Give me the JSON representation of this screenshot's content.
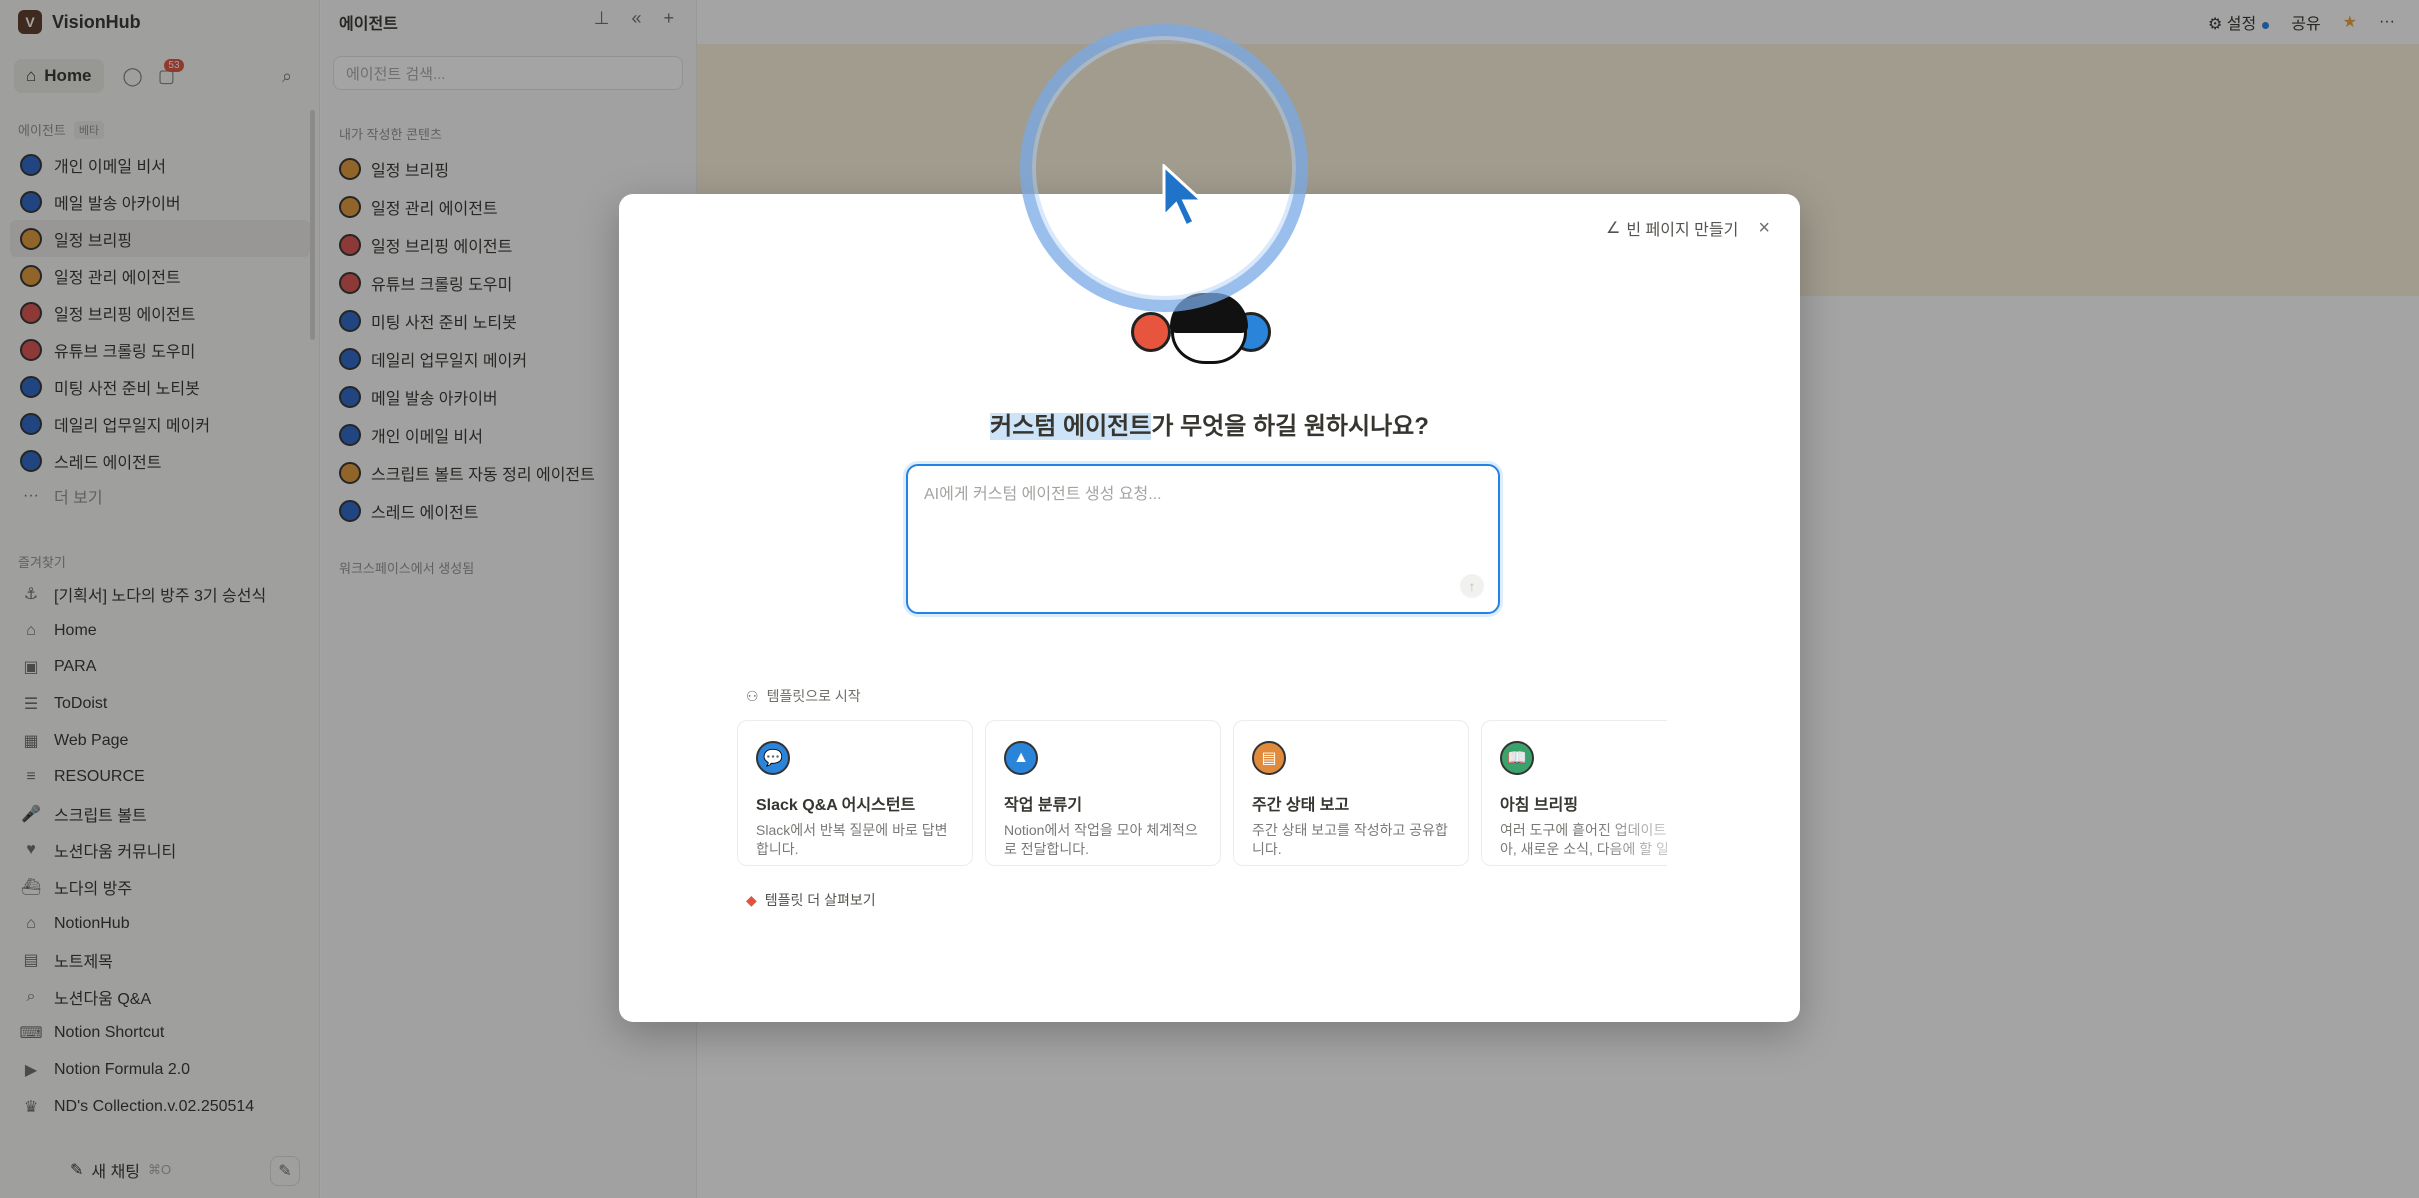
{
  "workspace": {
    "name": "VisionHub",
    "logo": "V"
  },
  "top_nav": {
    "home_label": "Home",
    "inbox_badge": "53"
  },
  "sidebar": {
    "agents_label": "에이전트",
    "beta_label": "베타",
    "agents": [
      {
        "label": "개인 이메일 비서",
        "icon": "agent-blue-icon",
        "color": "#2b67c6"
      },
      {
        "label": "메일 발송 아카이버",
        "icon": "agent-blue-icon",
        "color": "#2b67c6"
      },
      {
        "label": "일정 브리핑",
        "icon": "alarm-clock-icon",
        "color": "#e09a3b",
        "active": true
      },
      {
        "label": "일정 관리 에이전트",
        "icon": "alarm-clock-icon",
        "color": "#e09a3b"
      },
      {
        "label": "일정 브리핑 에이전트",
        "icon": "alarm-clock-icon",
        "color": "#d9534f"
      },
      {
        "label": "유튜브 크롤링 도우미",
        "icon": "agent-red-icon",
        "color": "#d9534f"
      },
      {
        "label": "미팅 사전 준비 노티봇",
        "icon": "agent-blue-icon",
        "color": "#2b67c6"
      },
      {
        "label": "데일리 업무일지 메이커",
        "icon": "agent-blue-icon",
        "color": "#2b67c6"
      },
      {
        "label": "스레드 에이전트",
        "icon": "agent-blue-icon",
        "color": "#2b67c6"
      }
    ],
    "more_label": "더 보기",
    "favorites_label": "즐겨찾기",
    "favorites": [
      {
        "label": "[기획서] 노다의 방주 3기 승선식",
        "glyph": "⚓"
      },
      {
        "label": "Home",
        "glyph": "⌂"
      },
      {
        "label": "PARA",
        "glyph": "▣"
      },
      {
        "label": "ToDoist",
        "glyph": "☰"
      },
      {
        "label": "Web Page",
        "glyph": "▦"
      },
      {
        "label": "RESOURCE",
        "glyph": "≡"
      },
      {
        "label": "스크립트 볼트",
        "glyph": "🎤"
      },
      {
        "label": "노션다움 커뮤니티",
        "glyph": "♥"
      },
      {
        "label": "노다의 방주",
        "glyph": "⛴"
      },
      {
        "label": "NotionHub",
        "glyph": "⌂"
      },
      {
        "label": "노트제목",
        "glyph": "▤"
      },
      {
        "label": "노션다움 Q&A",
        "glyph": "⌕"
      },
      {
        "label": "Notion Shortcut",
        "glyph": "⌨"
      },
      {
        "label": "Notion Formula 2.0",
        "glyph": "▶"
      },
      {
        "label": "ND's Collection.v.02.250514",
        "glyph": "♛"
      }
    ],
    "new_chat_label": "새 채팅",
    "new_chat_shortcut": "⌘O"
  },
  "panel": {
    "title": "에이전트",
    "search_placeholder": "에이전트 검색...",
    "my_content_label": "내가 작성한 콘텐츠",
    "items": [
      {
        "label": "일정 브리핑",
        "color": "#e09a3b"
      },
      {
        "label": "일정 관리 에이전트",
        "color": "#e09a3b"
      },
      {
        "label": "일정 브리핑 에이전트",
        "color": "#d9534f"
      },
      {
        "label": "유튜브 크롤링 도우미",
        "color": "#d9534f"
      },
      {
        "label": "미팅 사전 준비 노티봇",
        "color": "#2b67c6"
      },
      {
        "label": "데일리 업무일지 메이커",
        "color": "#2b67c6"
      },
      {
        "label": "메일 발송 아카이버",
        "color": "#2b67c6"
      },
      {
        "label": "개인 이메일 비서",
        "color": "#2b67c6"
      },
      {
        "label": "스크립트 볼트 자동 정리 에이전트",
        "color": "#e09a3b"
      },
      {
        "label": "스레드 에이전트",
        "color": "#2b67c6"
      }
    ],
    "workspace_label": "워크스페이스에서 생성됨"
  },
  "topbar": {
    "settings_label": "설정",
    "share_label": "공유"
  },
  "modal": {
    "blank_page_label": "빈 페이지 만들기",
    "title_highlight": "커스텀 에이전트",
    "title_rest": "가 무엇을 하길 원하시나요?",
    "prompt_placeholder": "AI에게 커스텀 에이전트 생성 요청...",
    "templates_label": "템플릿으로 시작",
    "templates": [
      {
        "title": "Slack Q&A 어시스턴트",
        "desc": "Slack에서 반복 질문에 바로 답변합니다.",
        "icon": "chat-bubble-icon",
        "color": "#2a84d9"
      },
      {
        "title": "작업 분류기",
        "desc": "Notion에서 작업을 모아 체계적으로 전달합니다.",
        "icon": "sorting-hat-icon",
        "color": "#2a84d9"
      },
      {
        "title": "주간 상태 보고",
        "desc": "주간 상태 보고를 작성하고 공유합니다.",
        "icon": "clipboard-icon",
        "color": "#e08a3b"
      },
      {
        "title": "아침 브리핑",
        "desc": "여러 도구에 흩어진 업데이트를 모아, 새로운 소식, 다음에 할 일",
        "icon": "book-icon",
        "color": "#3aa36b"
      }
    ],
    "more_templates_label": "템플릿 더 살펴보기"
  }
}
